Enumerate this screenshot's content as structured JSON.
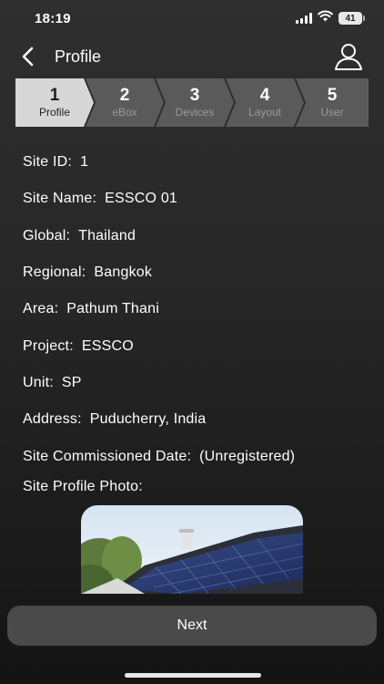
{
  "status_bar": {
    "time": "18:19",
    "battery": "41",
    "icons": [
      "signal-icon",
      "wifi-icon",
      "battery-icon"
    ]
  },
  "nav": {
    "title": "Profile",
    "back_icon": "chevron-left-icon",
    "user_icon": "user-icon"
  },
  "stepper": {
    "active_index": 0,
    "steps": [
      {
        "number": "1",
        "label": "Profile"
      },
      {
        "number": "2",
        "label": "eBox"
      },
      {
        "number": "3",
        "label": "Devices"
      },
      {
        "number": "4",
        "label": "Layout"
      },
      {
        "number": "5",
        "label": "User"
      }
    ]
  },
  "site": {
    "fields": [
      {
        "label": "Site ID",
        "value": "1"
      },
      {
        "label": "Site Name",
        "value": "ESSCO 01"
      },
      {
        "label": "Global",
        "value": "Thailand"
      },
      {
        "label": "Regional",
        "value": "Bangkok"
      },
      {
        "label": "Area",
        "value": "Pathum Thani"
      },
      {
        "label": "Project",
        "value": "ESSCO"
      },
      {
        "label": "Unit",
        "value": "SP"
      },
      {
        "label": "Address",
        "value": "Puducherry, India"
      },
      {
        "label": "Site Commissioned Date",
        "value": "(Unregistered)"
      }
    ],
    "photo_label": "Site Profile Photo:"
  },
  "footer": {
    "next_label": "Next"
  },
  "colors": {
    "background_top": "#2f2f2f",
    "background_bottom": "#141414",
    "step_active": "#d7d7d7",
    "step_inactive": "#5a5a5a",
    "button": "#4a4a4a"
  }
}
